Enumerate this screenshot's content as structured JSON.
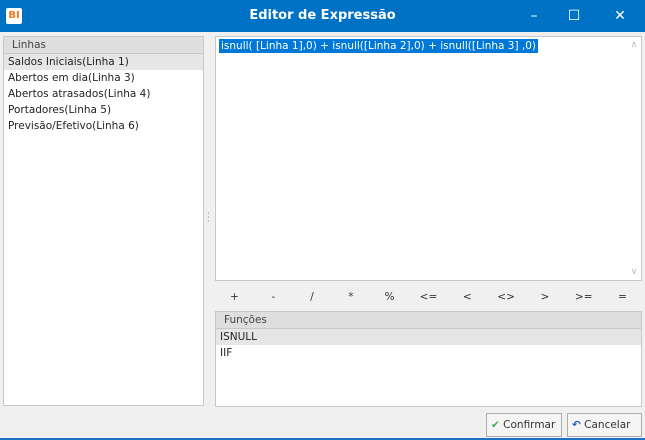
{
  "window": {
    "title": "Editor de Expressão",
    "logo": "BI",
    "minimize": "–",
    "maximize": "☐",
    "close": "✕"
  },
  "linhas": {
    "header": "Linhas",
    "items": [
      "Saldos Iniciais(Linha 1)",
      "Abertos em dia(Linha 3)",
      "Abertos atrasados(Linha 4)",
      "Portadores(Linha 5)",
      "Previsão/Efetivo(Linha 6)"
    ]
  },
  "editor": {
    "expression": "isnull( [Linha 1],0) + isnull([Linha 2],0) + isnull([Linha 3] ,0)"
  },
  "operators": [
    "+",
    "-",
    "/",
    "*",
    "%",
    "<=",
    "<",
    "<>",
    ">",
    ">=",
    "="
  ],
  "funcoes": {
    "header": "Funções",
    "items": [
      "ISNULL",
      "IIF"
    ]
  },
  "buttons": {
    "confirm": "Confirmar",
    "cancel": "Cancelar"
  }
}
